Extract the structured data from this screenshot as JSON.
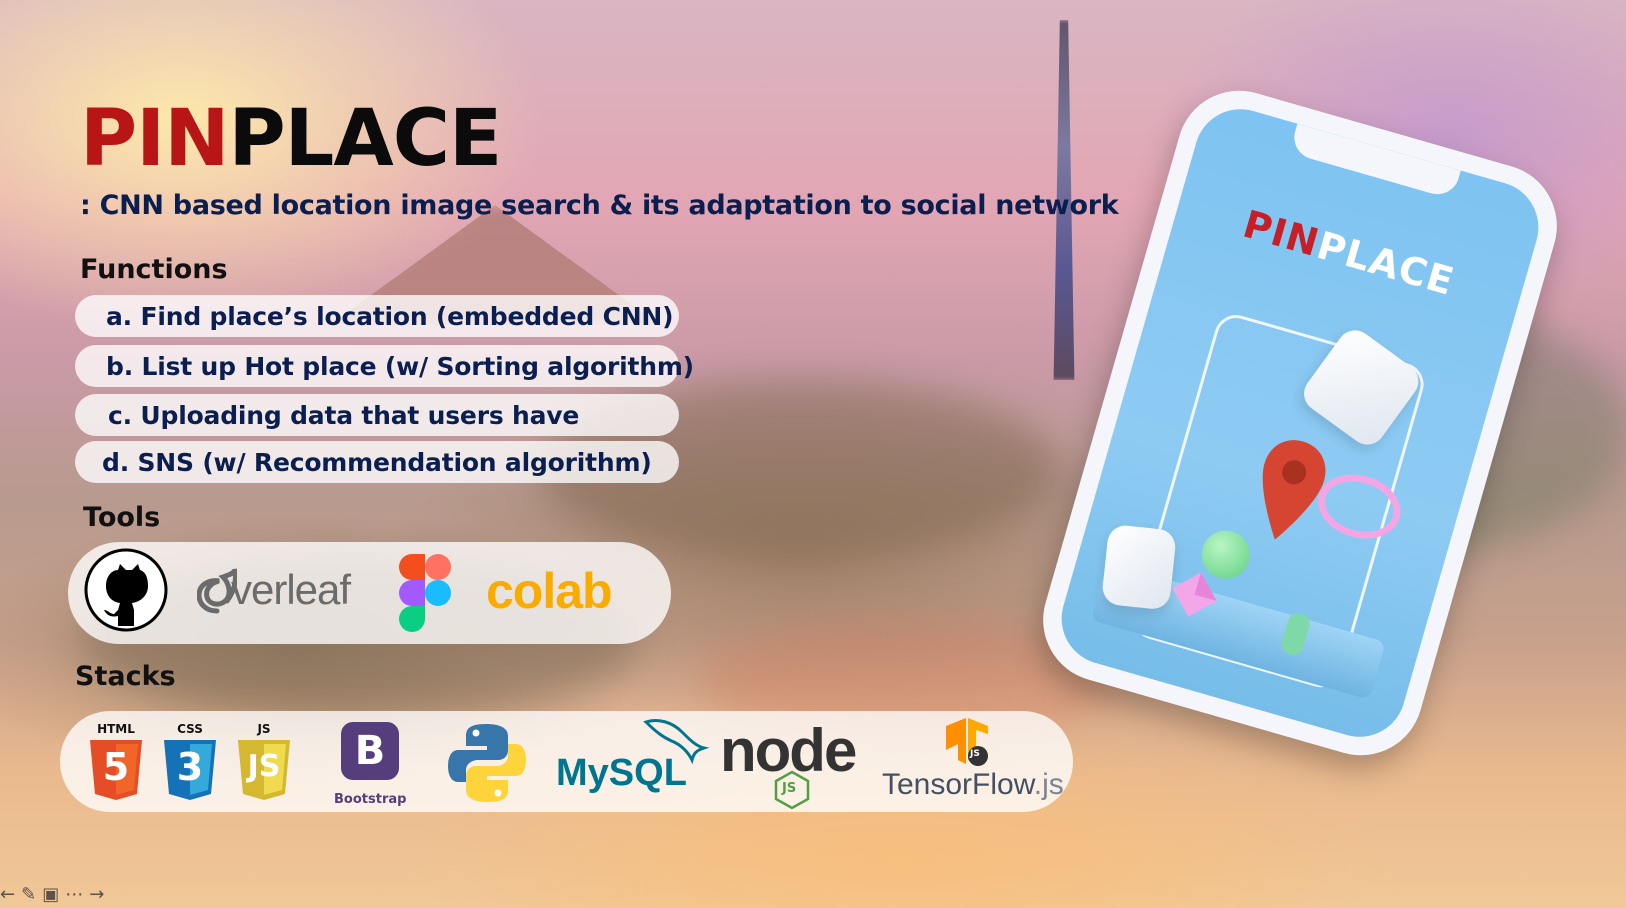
{
  "slide": {
    "title_part1": "PIN",
    "title_part2": "PLACE",
    "subtitle": ": CNN based location image search &  its adaptation to social network",
    "functions_heading": "Functions",
    "functions": [
      "a. Find place’s location (embedded CNN)",
      "b. List up Hot place (w/ Sorting algorithm)",
      "c. Uploading data that users have",
      "d. SNS (w/ Recommendation algorithm)"
    ],
    "tools_heading": "Tools",
    "tools": [
      {
        "name": "github-icon"
      },
      {
        "name": "overleaf-logo",
        "label": "Overleaf"
      },
      {
        "name": "figma-icon"
      },
      {
        "name": "colab-logo",
        "label": "colab"
      }
    ],
    "stacks_heading": "Stacks",
    "stacks": {
      "html_label": "HTML",
      "html_num": "5",
      "css_label": "CSS",
      "css_num": "3",
      "js_label": "JS",
      "js_text": "JS",
      "bootstrap_letter": "B",
      "bootstrap_label": "Bootstrap",
      "mysql_label": "MySQL",
      "node_label": "node",
      "node_js": "JS",
      "tensorflow_label": "TensorFlow",
      "tensorflow_suffix": ".js",
      "tensorflow_badge": "JS"
    },
    "phone": {
      "title_part1": "PIN",
      "title_part2": "PLACE"
    }
  },
  "toolbar": {
    "icons": [
      "prev-arrow-icon",
      "pen-icon",
      "slides-grid-icon",
      "more-icon",
      "next-arrow-icon"
    ]
  },
  "colors": {
    "brand_red": "#b81616",
    "text_navy": "#0a1f4f",
    "phone_screen": "#7ec3f1"
  }
}
